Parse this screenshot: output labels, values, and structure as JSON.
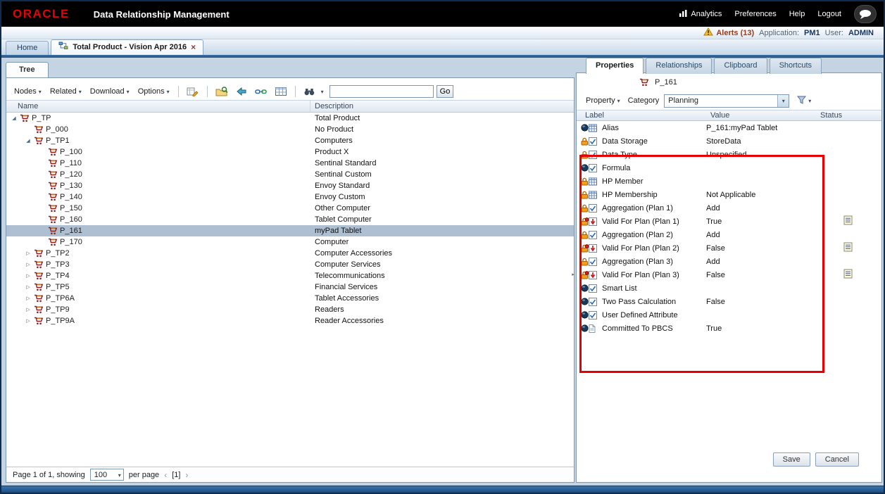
{
  "header": {
    "brand": "ORACLE",
    "title": "Data Relationship Management",
    "links": {
      "analytics": "Analytics",
      "preferences": "Preferences",
      "help": "Help",
      "logout": "Logout"
    }
  },
  "infobar": {
    "alerts": "Alerts (13)",
    "application_label": "Application:",
    "application_value": "PM1",
    "user_label": "User:",
    "user_value": "ADMIN"
  },
  "tabstrip": {
    "home": "Home",
    "document": "Total Product - Vision Apr 2016",
    "close": "×"
  },
  "tree": {
    "tab": "Tree",
    "menus": {
      "nodes": "Nodes",
      "related": "Related",
      "download": "Download",
      "options": "Options"
    },
    "search_value": "",
    "go": "Go",
    "columns": {
      "name": "Name",
      "description": "Description"
    },
    "rows": [
      {
        "name": "P_TP",
        "description": "Total Product",
        "level": 0,
        "state": "expanded"
      },
      {
        "name": "P_000",
        "description": "No Product",
        "level": 1,
        "state": "leaf"
      },
      {
        "name": "P_TP1",
        "description": "Computers",
        "level": 1,
        "state": "expanded"
      },
      {
        "name": "P_100",
        "description": "Product X",
        "level": 2,
        "state": "leaf"
      },
      {
        "name": "P_110",
        "description": "Sentinal Standard",
        "level": 2,
        "state": "leaf"
      },
      {
        "name": "P_120",
        "description": "Sentinal Custom",
        "level": 2,
        "state": "leaf"
      },
      {
        "name": "P_130",
        "description": "Envoy Standard",
        "level": 2,
        "state": "leaf"
      },
      {
        "name": "P_140",
        "description": "Envoy Custom",
        "level": 2,
        "state": "leaf"
      },
      {
        "name": "P_150",
        "description": "Other Computer",
        "level": 2,
        "state": "leaf"
      },
      {
        "name": "P_160",
        "description": "Tablet Computer",
        "level": 2,
        "state": "leaf"
      },
      {
        "name": "P_161",
        "description": "myPad Tablet",
        "level": 2,
        "state": "leaf",
        "selected": true
      },
      {
        "name": "P_170",
        "description": "Computer",
        "level": 2,
        "state": "leaf"
      },
      {
        "name": "P_TP2",
        "description": "Computer Accessories",
        "level": 1,
        "state": "collapsed"
      },
      {
        "name": "P_TP3",
        "description": "Computer Services",
        "level": 1,
        "state": "collapsed"
      },
      {
        "name": "P_TP4",
        "description": "Telecommunications",
        "level": 1,
        "state": "collapsed"
      },
      {
        "name": "P_TP5",
        "description": "Financial Services",
        "level": 1,
        "state": "collapsed"
      },
      {
        "name": "P_TP6A",
        "description": "Tablet Accessories",
        "level": 1,
        "state": "collapsed"
      },
      {
        "name": "P_TP9",
        "description": "Readers",
        "level": 1,
        "state": "collapsed"
      },
      {
        "name": "P_TP9A",
        "description": "Reader Accessories",
        "level": 1,
        "state": "collapsed"
      }
    ],
    "pager": {
      "prefix": "Page 1 of 1, showing",
      "per_page": "100",
      "suffix": "per page",
      "prev": "‹",
      "page": "[1]",
      "next": "›"
    }
  },
  "properties": {
    "tabs": [
      {
        "label": "Properties"
      },
      {
        "label": "Relationships"
      },
      {
        "label": "Clipboard"
      },
      {
        "label": "Shortcuts"
      }
    ],
    "node": "P_161",
    "property_menu": "Property",
    "category_label": "Category",
    "category_value": "Planning",
    "columns": {
      "label": "Label",
      "value": "Value",
      "status": "Status"
    },
    "rows": [
      {
        "left_icon": "ball",
        "control_icon": "grid",
        "label": "Alias",
        "value": "P_161:myPad Tablet",
        "status": ""
      },
      {
        "left_icon": "lock",
        "control_icon": "check",
        "label": "Data Storage",
        "value": "StoreData",
        "status": ""
      },
      {
        "left_icon": "lock",
        "control_icon": "check",
        "label": "Data Type",
        "value": "Unspecified",
        "status": ""
      },
      {
        "left_icon": "ball",
        "control_icon": "check",
        "label": "Formula",
        "value": "",
        "status": ""
      },
      {
        "left_icon": "lock",
        "control_icon": "grid",
        "label": "HP Member",
        "value": "",
        "status": ""
      },
      {
        "left_icon": "lock",
        "control_icon": "grid",
        "label": "HP Membership",
        "value": "Not Applicable",
        "status": ""
      },
      {
        "left_icon": "lock",
        "control_icon": "check",
        "label": "Aggregation (Plan 1)",
        "value": "Add",
        "status": ""
      },
      {
        "left_icon": "lock_red",
        "control_icon": "redarrow",
        "label": "Valid For Plan (Plan 1)",
        "value": "True",
        "status": "memo"
      },
      {
        "left_icon": "lock",
        "control_icon": "check",
        "label": "Aggregation (Plan 2)",
        "value": "Add",
        "status": ""
      },
      {
        "left_icon": "lock_red",
        "control_icon": "redarrow",
        "label": "Valid For Plan (Plan 2)",
        "value": "False",
        "status": "memo"
      },
      {
        "left_icon": "lock",
        "control_icon": "check",
        "label": "Aggregation (Plan 3)",
        "value": "Add",
        "status": ""
      },
      {
        "left_icon": "lock_red",
        "control_icon": "redarrow",
        "label": "Valid For Plan (Plan 3)",
        "value": "False",
        "status": "memo"
      },
      {
        "left_icon": "ball",
        "control_icon": "check",
        "label": "Smart List",
        "value": "",
        "status": ""
      },
      {
        "left_icon": "ball",
        "control_icon": "check",
        "label": "Two Pass Calculation",
        "value": "False",
        "status": ""
      },
      {
        "left_icon": "ball",
        "control_icon": "check",
        "label": "User Defined Attribute",
        "value": "",
        "status": ""
      },
      {
        "left_icon": "ball",
        "control_icon": "doc",
        "label": "Committed To PBCS",
        "value": "True",
        "status": ""
      }
    ],
    "buttons": {
      "save": "Save",
      "cancel": "Cancel"
    }
  },
  "colors": {
    "brand_red": "#e80000",
    "annotation_red": "#e80000",
    "selected_row": "#aebfd2",
    "statusbar_blue": "#1d4e80"
  }
}
